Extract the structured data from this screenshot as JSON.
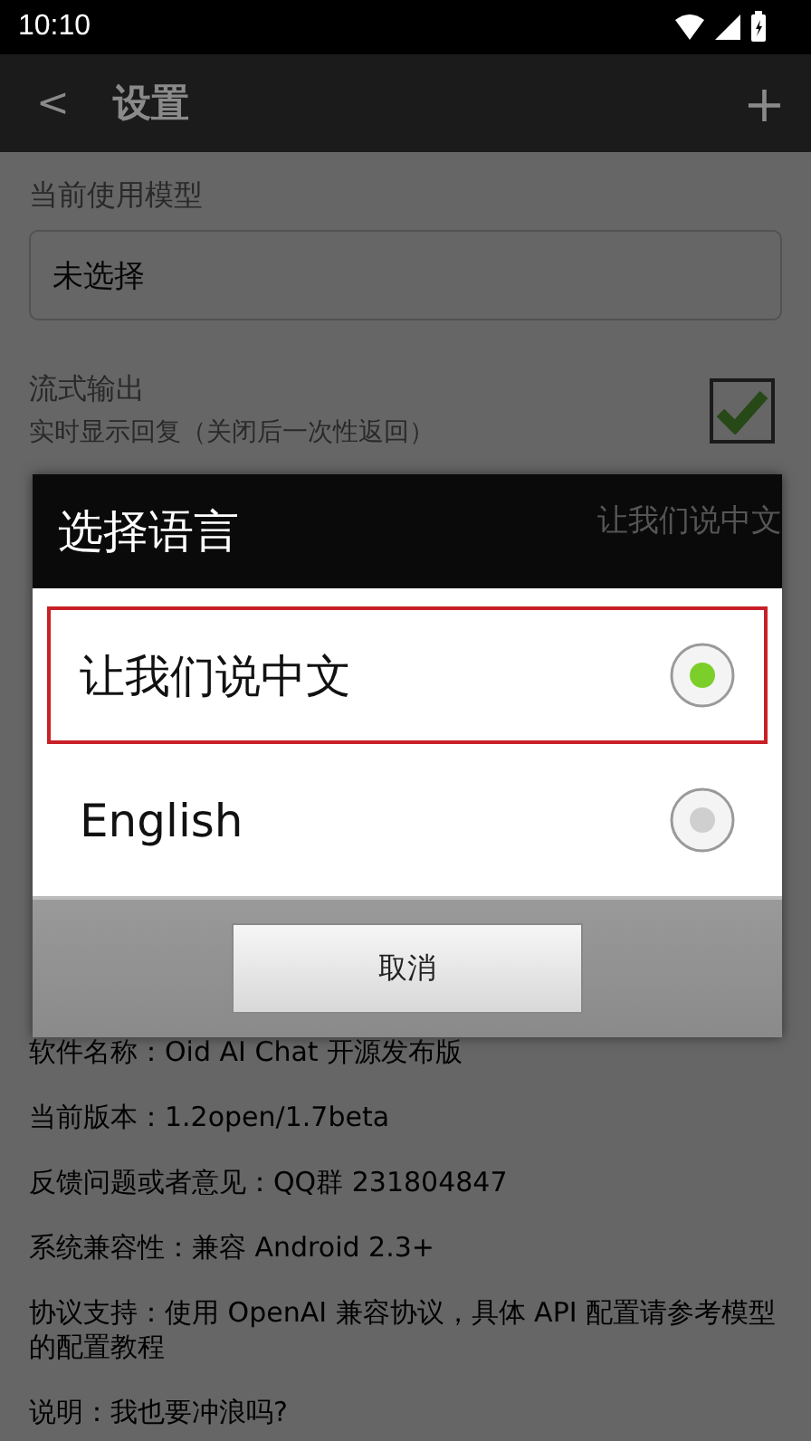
{
  "status_bar": {
    "time": "10:10"
  },
  "app_bar": {
    "back": "<",
    "title": "设置",
    "add": "+"
  },
  "settings": [
    {
      "kind": "field",
      "label": "当前使用模型",
      "value": "未选择"
    },
    {
      "kind": "toggle",
      "label": "流式输出",
      "subtitle": "实时显示回复（关闭后一次性返回）",
      "checked": true
    },
    {
      "kind": "value",
      "value": "让我们说中文"
    }
  ],
  "info": [
    "软件名称：Oid AI Chat 开源发布版",
    "当前版本：1.2open/1.7beta",
    "反馈问题或者意见：QQ群 231804847",
    "系统兼容性：兼容 Android 2.3+",
    "协议支持：使用 OpenAI 兼容协议，具体 API 配置请参考模型的配置教程",
    "说明：我也要冲浪吗?"
  ],
  "dialog": {
    "title": "选择语言",
    "options": [
      {
        "label": "让我们说中文",
        "selected": true,
        "focused": true
      },
      {
        "label": "English",
        "selected": false,
        "focused": false
      }
    ],
    "cancel": "取消"
  }
}
